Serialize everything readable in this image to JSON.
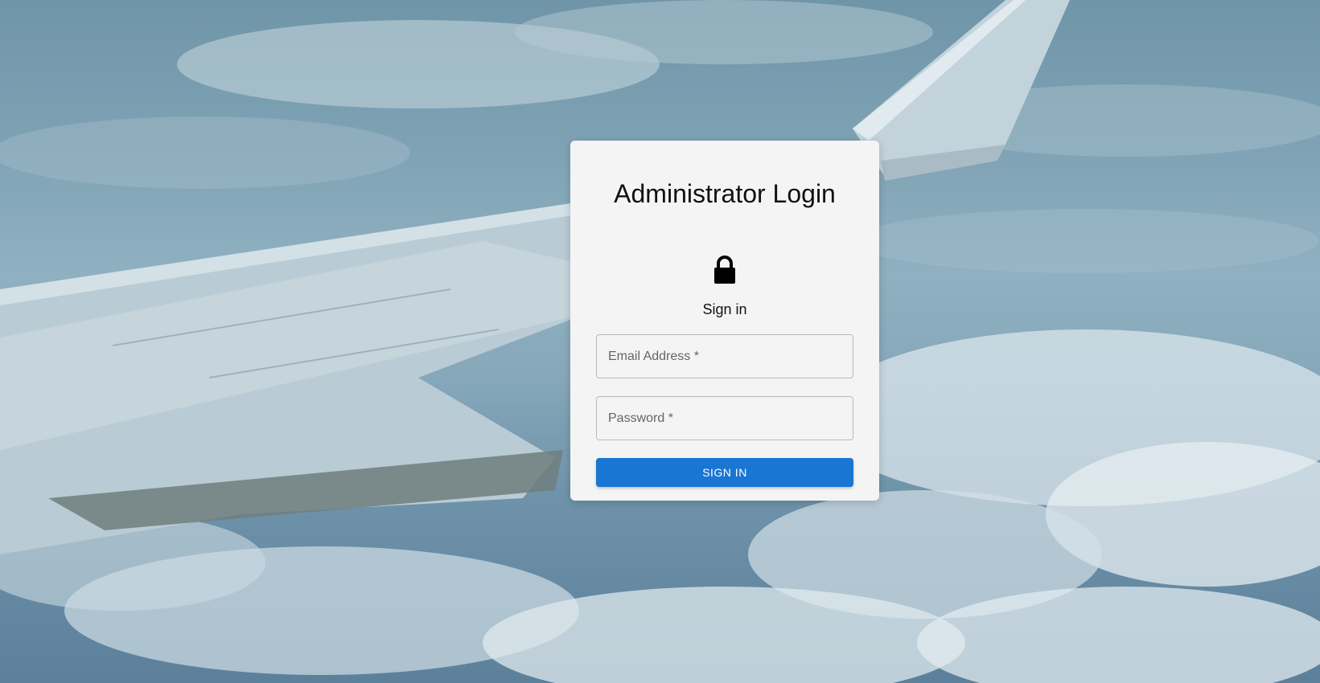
{
  "login": {
    "title": "Administrator Login",
    "subtitle": "Sign in",
    "email_placeholder": "Email Address *",
    "email_value": "",
    "password_placeholder": "Password *",
    "password_value": "",
    "submit_label": "SIGN IN"
  },
  "icons": {
    "lock": "lock-icon"
  },
  "colors": {
    "accent": "#1976d2",
    "card_background": "#f4f4f4"
  }
}
